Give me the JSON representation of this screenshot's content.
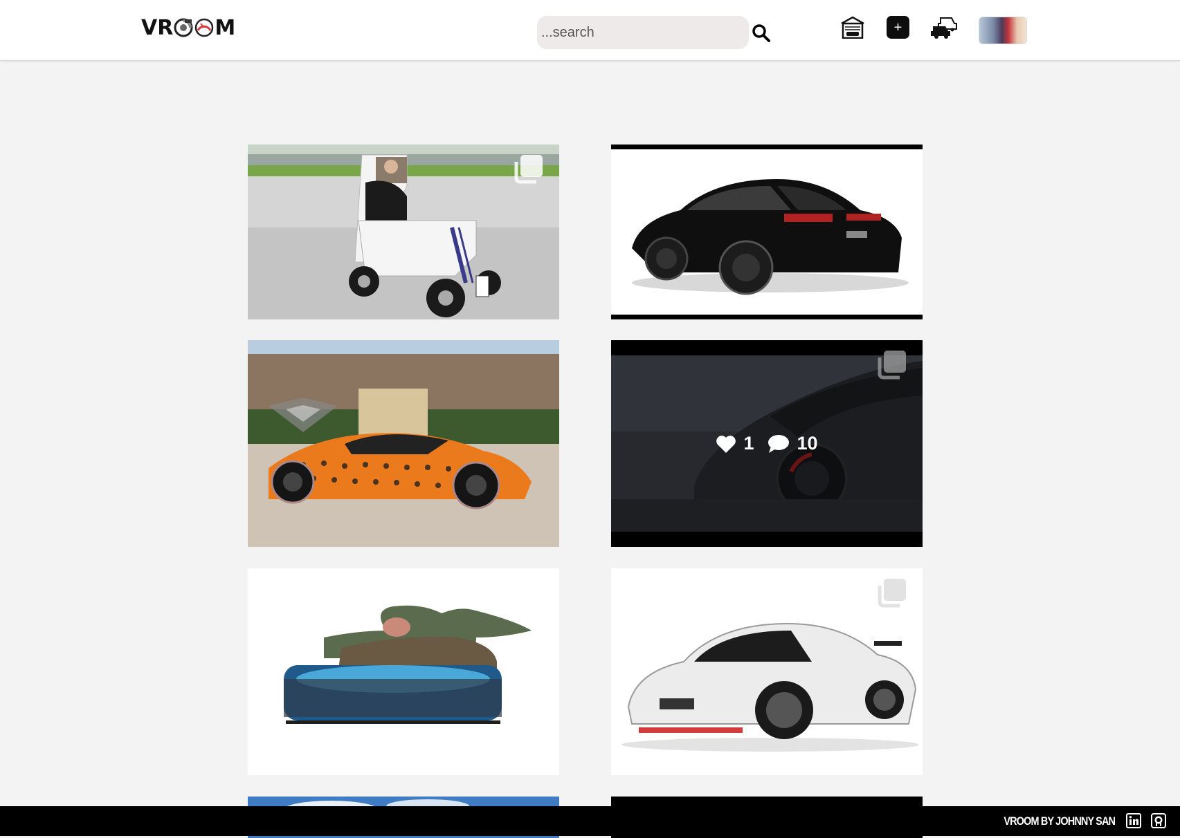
{
  "app": {
    "logo_text_left": "VR",
    "logo_text_right": "M"
  },
  "search": {
    "placeholder": "...search",
    "value": ""
  },
  "nav": {
    "icons": [
      "garage-icon",
      "add-post-icon",
      "traffic-cars-icon",
      "user-avatar"
    ],
    "add_symbol": "+"
  },
  "posts": [
    {
      "id": "post-1",
      "subject": "white-mobility-car",
      "multi_image": true
    },
    {
      "id": "post-2",
      "subject": "black-lexus-sedan",
      "multi_image": false
    },
    {
      "id": "post-3",
      "subject": "orange-bitcoin-lamborghini",
      "multi_image": false
    },
    {
      "id": "post-4",
      "subject": "dark-toyota-hatchback",
      "multi_image": true,
      "hovered": true,
      "likes": "1",
      "comments": "10"
    },
    {
      "id": "post-5",
      "subject": "baby-yoda-cutout",
      "multi_image": false
    },
    {
      "id": "post-6",
      "subject": "white-nissan-gtr",
      "multi_image": true
    },
    {
      "id": "post-7",
      "subject": "sky-photo",
      "multi_image": false
    },
    {
      "id": "post-8",
      "subject": "dark-photo",
      "multi_image": false
    }
  ],
  "footer": {
    "credit": "VROOM BY JOHNNY SAN",
    "links": [
      "linkedin-icon",
      "github-icon"
    ]
  },
  "colors": {
    "navbar_bg": "#ffffff",
    "page_bg": "#f3f3f3",
    "footer_bg": "#000000",
    "search_bg": "#eeeaea",
    "accent_red": "#d43a3a"
  }
}
